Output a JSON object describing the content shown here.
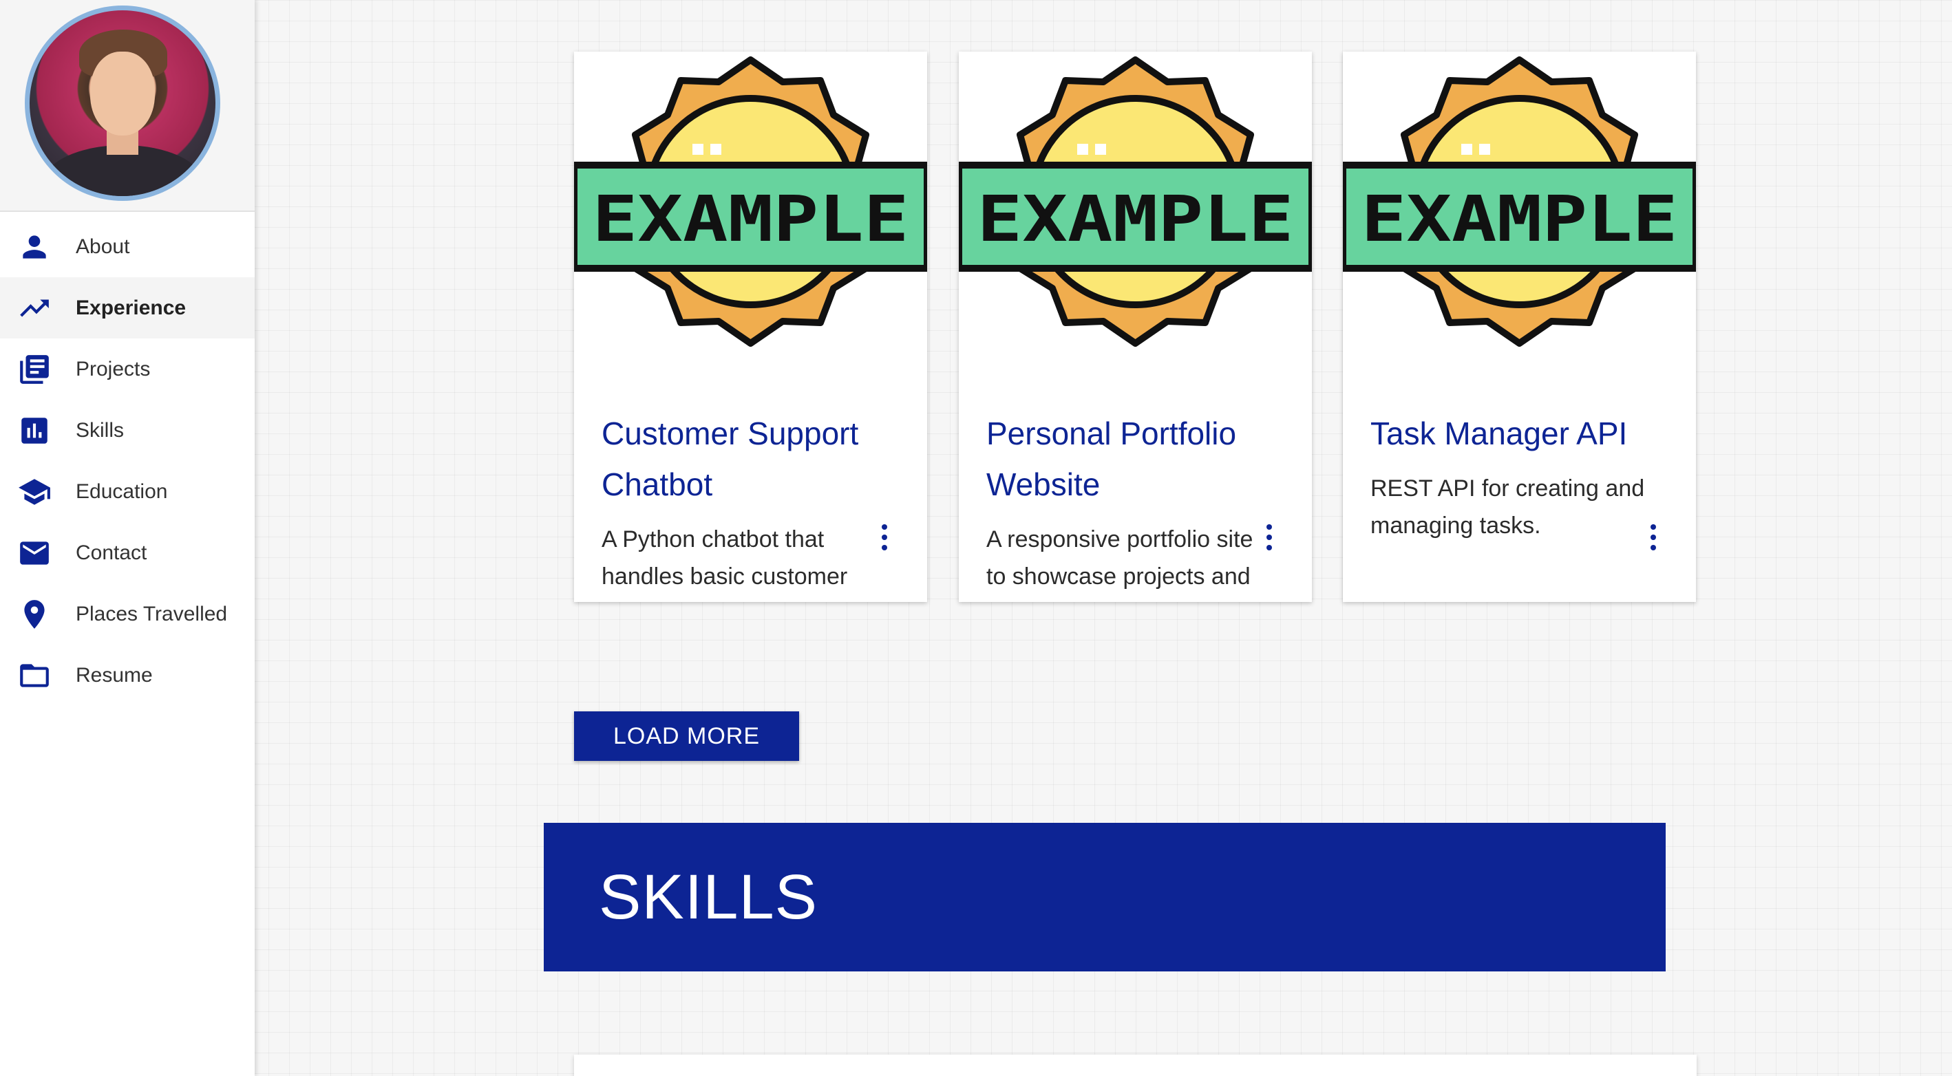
{
  "sidebar": {
    "items": [
      {
        "label": "About",
        "icon": "person-icon"
      },
      {
        "label": "Experience",
        "icon": "trending-up-icon"
      },
      {
        "label": "Projects",
        "icon": "library-books-icon"
      },
      {
        "label": "Skills",
        "icon": "bar-chart-icon"
      },
      {
        "label": "Education",
        "icon": "graduation-cap-icon"
      },
      {
        "label": "Contact",
        "icon": "mail-icon"
      },
      {
        "label": "Places Travelled",
        "icon": "location-pin-icon"
      },
      {
        "label": "Resume",
        "icon": "folder-icon"
      }
    ],
    "active": "Experience"
  },
  "projects": [
    {
      "badge": "EXAMPLE",
      "title": "Customer Support Chatbot",
      "description": "A Python chatbot that handles basic customer"
    },
    {
      "badge": "EXAMPLE",
      "title": "Personal Portfolio Website",
      "description": "A responsive portfolio site to showcase projects and"
    },
    {
      "badge": "EXAMPLE",
      "title": "Task Manager API",
      "description": "REST API for creating and managing tasks."
    }
  ],
  "load_more_label": "LOAD MORE",
  "skills_heading": "SKILLS",
  "colors": {
    "primary": "#0d2494",
    "badge_orange": "#f0ad4e",
    "badge_yellow": "#fbe774",
    "badge_green": "#67d39e"
  }
}
